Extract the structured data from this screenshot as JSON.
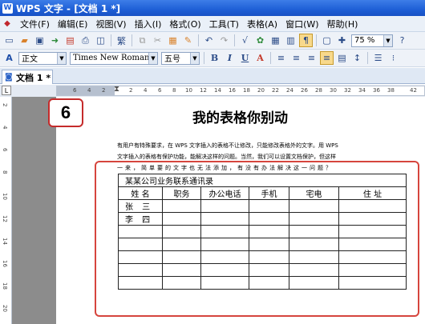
{
  "window": {
    "title": "WPS 文字 - [文档 1 *]",
    "app_icon": "W"
  },
  "menubar": {
    "items": [
      "文件(F)",
      "编辑(E)",
      "视图(V)",
      "插入(I)",
      "格式(O)",
      "工具(T)",
      "表格(A)",
      "窗口(W)",
      "帮助(H)"
    ]
  },
  "toolbar": {
    "zoom": "75 %",
    "style_value": "正文",
    "font_value": "Times New Roman",
    "size_value": "五号",
    "bold_label": "B",
    "italic_label": "I",
    "underline_label": "U",
    "fontcolor_label": "A"
  },
  "tab": {
    "label": "文档 1 *"
  },
  "ruler": {
    "corner": "L",
    "h_ticks": [
      "6",
      "4",
      "2",
      "2",
      "4",
      "6",
      "8",
      "10",
      "12",
      "14",
      "16",
      "18",
      "20",
      "22",
      "24",
      "26",
      "28",
      "30",
      "32",
      "34",
      "36",
      "38",
      "42"
    ],
    "v_ticks": [
      "2",
      "4",
      "6",
      "8",
      "10",
      "12",
      "14",
      "16",
      "18",
      "20"
    ]
  },
  "step_badge": "6",
  "document": {
    "title": "我的表格你别动",
    "paragraph": [
      "有用户有特殊要求，在 WPS 文字插入的表格不让修改，只能修改表格外的文字。用 WPS",
      "文字插入的表格有保护功能，能解决这样的问题。当然，我们可以设置文档保护，但这样",
      "一来，简单要的文字也无法添加，有没有办法解决这一问题？"
    ],
    "table": {
      "title": "某某公司业务联系通讯录",
      "headers": [
        "姓 名",
        "职务",
        "办公电话",
        "手机",
        "宅电",
        "住 址"
      ],
      "rows": [
        [
          "张 三",
          "",
          "",
          "",
          "",
          ""
        ],
        [
          "李 四",
          "",
          "",
          "",
          "",
          ""
        ],
        [
          "",
          "",
          "",
          "",
          "",
          ""
        ],
        [
          "",
          "",
          "",
          "",
          "",
          ""
        ],
        [
          "",
          "",
          "",
          "",
          "",
          ""
        ],
        [
          "",
          "",
          "",
          "",
          "",
          ""
        ],
        [
          "",
          "",
          "",
          "",
          "",
          ""
        ]
      ]
    }
  },
  "colors": {
    "titlebar": "#1e5fd6",
    "highlight": "#d6453d",
    "active_button": "#f8d98c"
  }
}
